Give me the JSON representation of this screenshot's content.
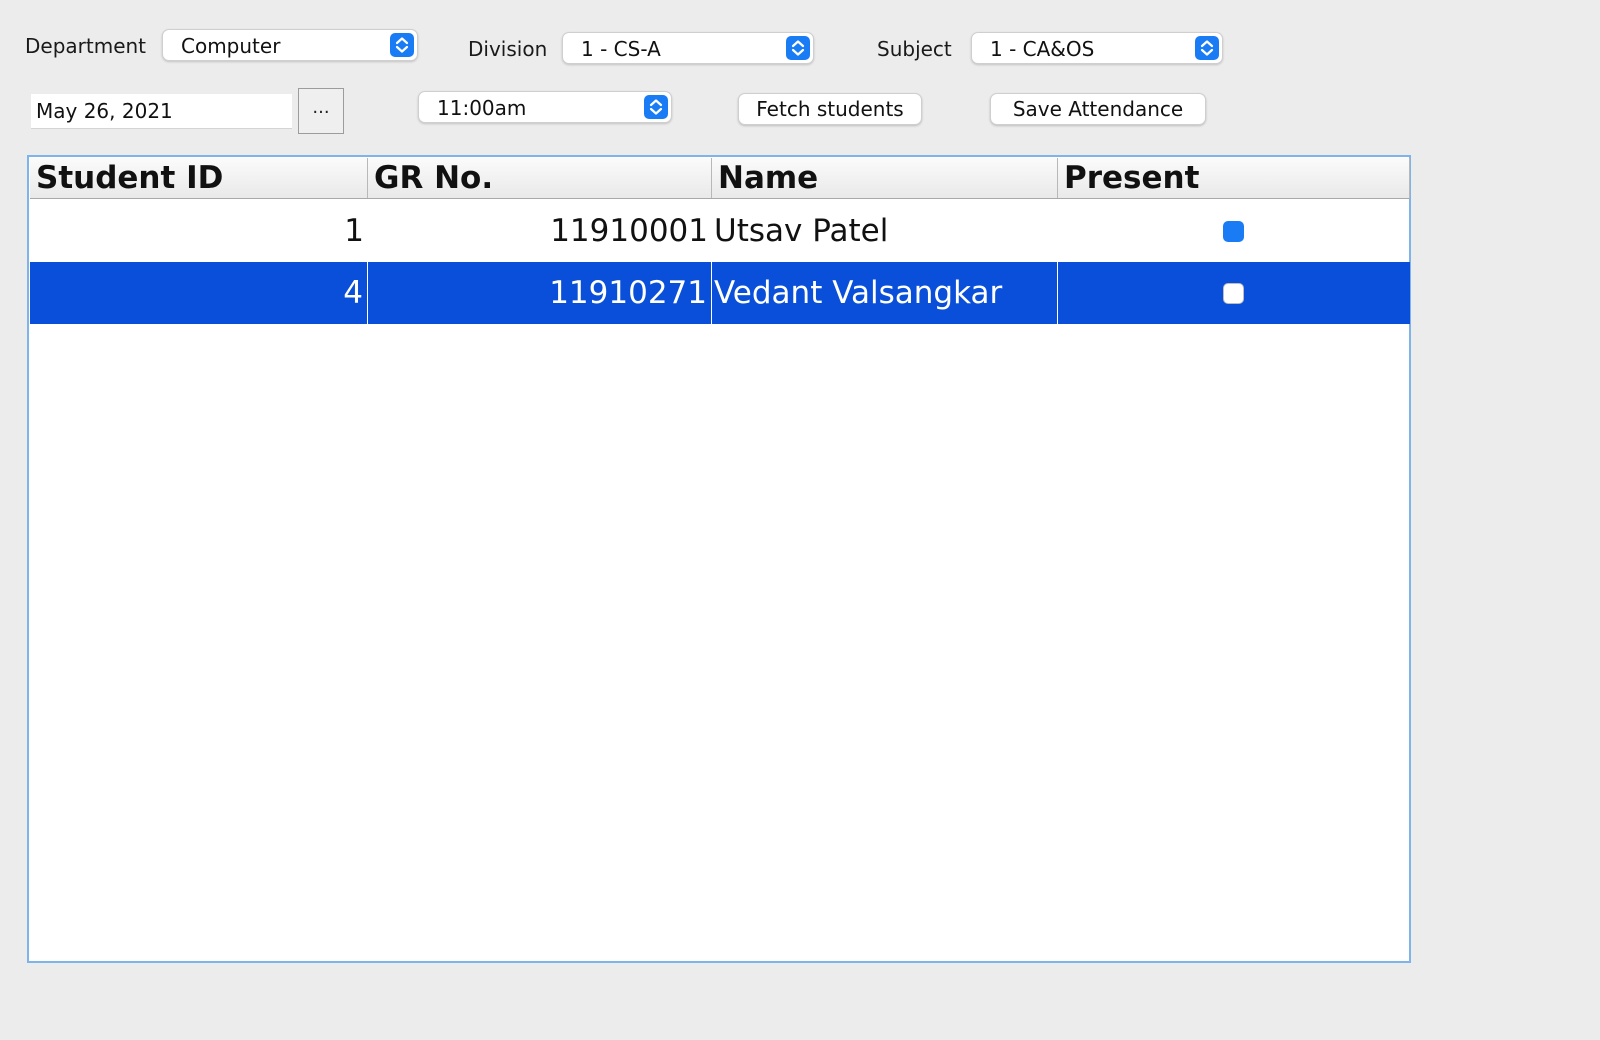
{
  "filters": {
    "department_label": "Department",
    "department_value": "Computer",
    "division_label": "Division",
    "division_value": "1 - CS-A",
    "subject_label": "Subject",
    "subject_value": "1 - CA&OS"
  },
  "date_time": {
    "date_value": "May 26, 2021",
    "date_picker_label": "...",
    "time_value": "11:00am"
  },
  "actions": {
    "fetch_label": "Fetch students",
    "save_label": "Save Attendance"
  },
  "table": {
    "columns": [
      "Student ID",
      "GR No.",
      "Name",
      "Present"
    ],
    "rows": [
      {
        "student_id": "1",
        "gr_no": "11910001",
        "name": "Utsav Patel",
        "present": true,
        "selected": false
      },
      {
        "student_id": "4",
        "gr_no": "11910271",
        "name": "Vedant Valsangkar",
        "present": false,
        "selected": true
      }
    ]
  },
  "colors": {
    "accent": "#1a7cf5",
    "selection": "#0a4fd9",
    "window_bg": "#ececec",
    "table_border": "#7fb4ea"
  },
  "icons": {
    "combo_stepper": "up-down-chevron-icon",
    "checkbox_checked": "checkmark-icon"
  }
}
